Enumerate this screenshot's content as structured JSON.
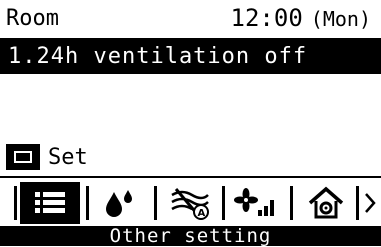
{
  "header": {
    "location": "Room",
    "time": "12:00",
    "day": "(Mon)"
  },
  "menu": {
    "selected_item": "1.24h ventilation off"
  },
  "hint": {
    "key_icon": "rectangle-key-icon",
    "label": "Set"
  },
  "toolbar": {
    "icons": [
      "list-icon",
      "water-drop-icon",
      "fan-auto-off-icon",
      "fan-speed-icon",
      "house-settings-icon"
    ],
    "active_index": 0,
    "more_icon": "chevron-right-icon"
  },
  "footer": {
    "title": "Other setting"
  }
}
